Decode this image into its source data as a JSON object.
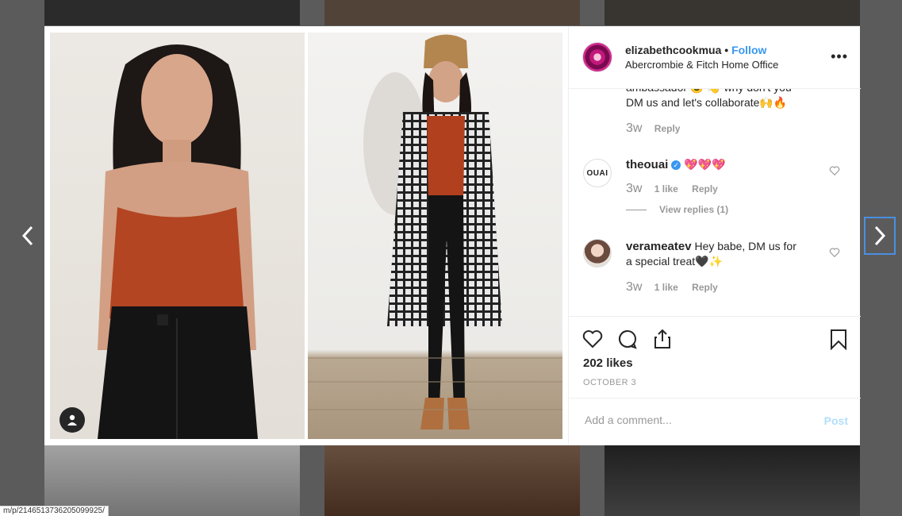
{
  "status_url": "m/p/2146513736205099925/",
  "post": {
    "username": "elizabethcookmua",
    "separator": "•",
    "follow_label": "Follow",
    "location": "Abercrombie & Fitch Home Office",
    "more_label": "•••"
  },
  "comments": [
    {
      "text_partial": "ambassador 😉 👋 why don't you",
      "text": "DM us and let's collaborate🙌🔥",
      "time": "3w",
      "reply_label": "Reply"
    },
    {
      "username": "theouai",
      "avatar_text": "OUAI",
      "text": "💖💖💖",
      "time": "3w",
      "likes": "1 like",
      "reply_label": "Reply",
      "view_replies": "View replies (1)"
    },
    {
      "username": "verameatev",
      "text": "Hey babe, DM us for",
      "text_line2": "a special treat🖤✨",
      "time": "3w",
      "likes": "1 like",
      "reply_label": "Reply"
    }
  ],
  "likes_count": "202 likes",
  "date": "OCTOBER 3",
  "add_comment_placeholder": "Add a comment...",
  "post_button": "Post",
  "icons": {
    "like": "heart-icon",
    "comment": "comment-icon",
    "share": "share-icon",
    "save": "bookmark-icon",
    "tag": "user-tag-icon",
    "prev": "chevron-left-icon",
    "next": "chevron-right-icon"
  },
  "colors": {
    "accent": "#3897f0",
    "post_disabled": "#b2dffc",
    "verified": "#3897f0"
  }
}
